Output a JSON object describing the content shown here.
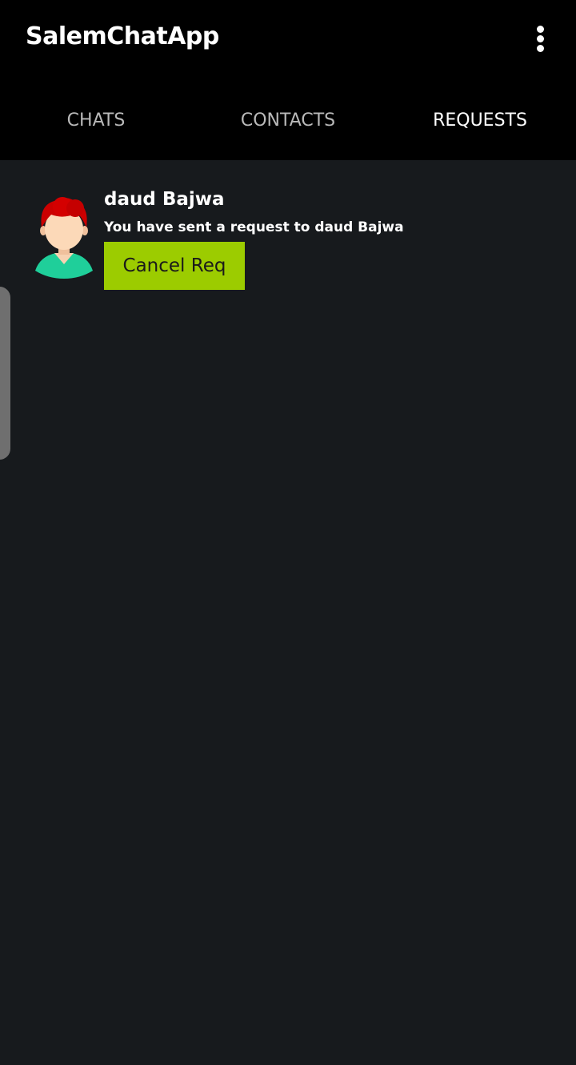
{
  "appbar": {
    "title": "SalemChatApp",
    "overflow_icon": "more-vert-icon"
  },
  "tabs": [
    {
      "label": "CHATS",
      "active": false
    },
    {
      "label": "CONTACTS",
      "active": false
    },
    {
      "label": "REQUESTS",
      "active": true
    }
  ],
  "requests": [
    {
      "name": "daud Bajwa",
      "message": "You have sent a request to daud Bajwa",
      "button_label": "Cancel Req",
      "avatar_icon": "user-avatar-icon"
    }
  ],
  "colors": {
    "appbar_bg": "#000000",
    "content_bg": "#171a1d",
    "button_bg": "#9ccc00",
    "tab_inactive": "#b9b9b9",
    "tab_active": "#ffffff"
  }
}
